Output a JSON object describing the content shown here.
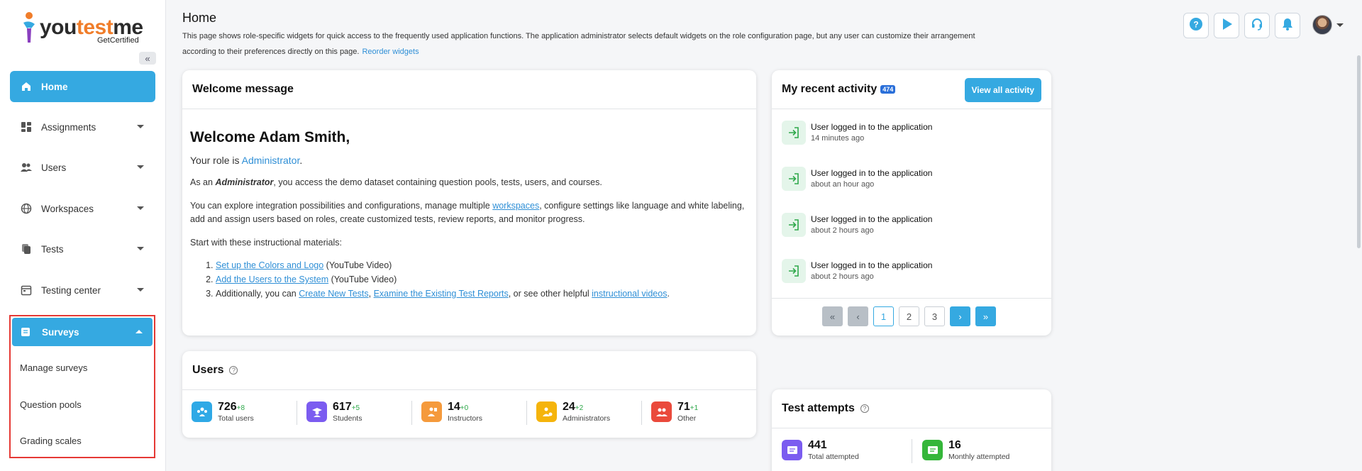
{
  "brand": {
    "logo_a": "you",
    "logo_b": "test",
    "logo_c": "me",
    "tagline": "GetCertified"
  },
  "sidebar": {
    "items": [
      {
        "label": "Home"
      },
      {
        "label": "Assignments"
      },
      {
        "label": "Users"
      },
      {
        "label": "Workspaces"
      },
      {
        "label": "Tests"
      },
      {
        "label": "Testing center"
      }
    ],
    "surveys": {
      "label": "Surveys",
      "children": [
        "Manage surveys",
        "Question pools",
        "Grading scales"
      ]
    }
  },
  "header": {
    "title": "Home",
    "description": "This page shows role-specific widgets for quick access to the frequently used application functions. The application administrator selects default widgets on the role configuration page, but any user can customize their arrangement according to their preferences directly on this page.",
    "reorder_link": "Reorder widgets"
  },
  "welcome": {
    "header": "Welcome message",
    "greeting": "Welcome Adam Smith,",
    "role_prefix": "Your role is ",
    "role": "Administrator",
    "role_suffix": ".",
    "p1_a": "As an ",
    "p1_role": "Administrator",
    "p1_b": ", you access the demo dataset containing question pools, tests, users, and courses.",
    "p2_a": "You can explore integration possibilities and configurations, manage multiple ",
    "p2_link": "workspaces",
    "p2_b": ", configure settings like language and white labeling, add and assign users based on roles, create customized tests, review reports, and monitor progress.",
    "p3": "Start with these instructional materials:",
    "li1_link": "Set up the Colors and Logo",
    "li1_suffix": " (YouTube Video)",
    "li2_link": "Add the Users to the System",
    "li2_suffix": " (YouTube Video)",
    "li3_a": "Additionally, you can ",
    "li3_link1": "Create New Tests",
    "li3_sep": ", ",
    "li3_link2": "Examine the Existing Test Reports",
    "li3_b": ", or see other helpful ",
    "li3_link3": "instructional videos",
    "li3_c": "."
  },
  "activity": {
    "header": "My recent activity",
    "count": "474",
    "view_all": "View all activity",
    "items": [
      {
        "title": "User logged in to the application",
        "time": "14 minutes ago"
      },
      {
        "title": "User logged in to the application",
        "time": "about an hour ago"
      },
      {
        "title": "User logged in to the application",
        "time": "about 2 hours ago"
      },
      {
        "title": "User logged in to the application",
        "time": "about 2 hours ago"
      }
    ],
    "pager": {
      "first": "«",
      "prev": "‹",
      "pages": [
        "1",
        "2",
        "3"
      ],
      "next": "›",
      "last": "»"
    }
  },
  "users_widget": {
    "header": "Users",
    "stats": [
      {
        "value": "726",
        "delta": "+8",
        "label": "Total users",
        "color": "#2fa9e6"
      },
      {
        "value": "617",
        "delta": "+5",
        "label": "Students",
        "color": "#7b5cf0"
      },
      {
        "value": "14",
        "delta": "+0",
        "label": "Instructors",
        "color": "#f59a3c"
      },
      {
        "value": "24",
        "delta": "+2",
        "label": "Administrators",
        "color": "#f5b40c"
      },
      {
        "value": "71",
        "delta": "+1",
        "label": "Other",
        "color": "#ea4a3c"
      }
    ]
  },
  "attempts_widget": {
    "header": "Test attempts",
    "stats": [
      {
        "value": "441",
        "label": "Total attempted",
        "color": "#7b5cf0"
      },
      {
        "value": "16",
        "label": "Monthly attempted",
        "color": "#35b63a"
      }
    ]
  },
  "colors": {
    "accent": "#35a9e1",
    "highlight_border": "#e53935"
  }
}
